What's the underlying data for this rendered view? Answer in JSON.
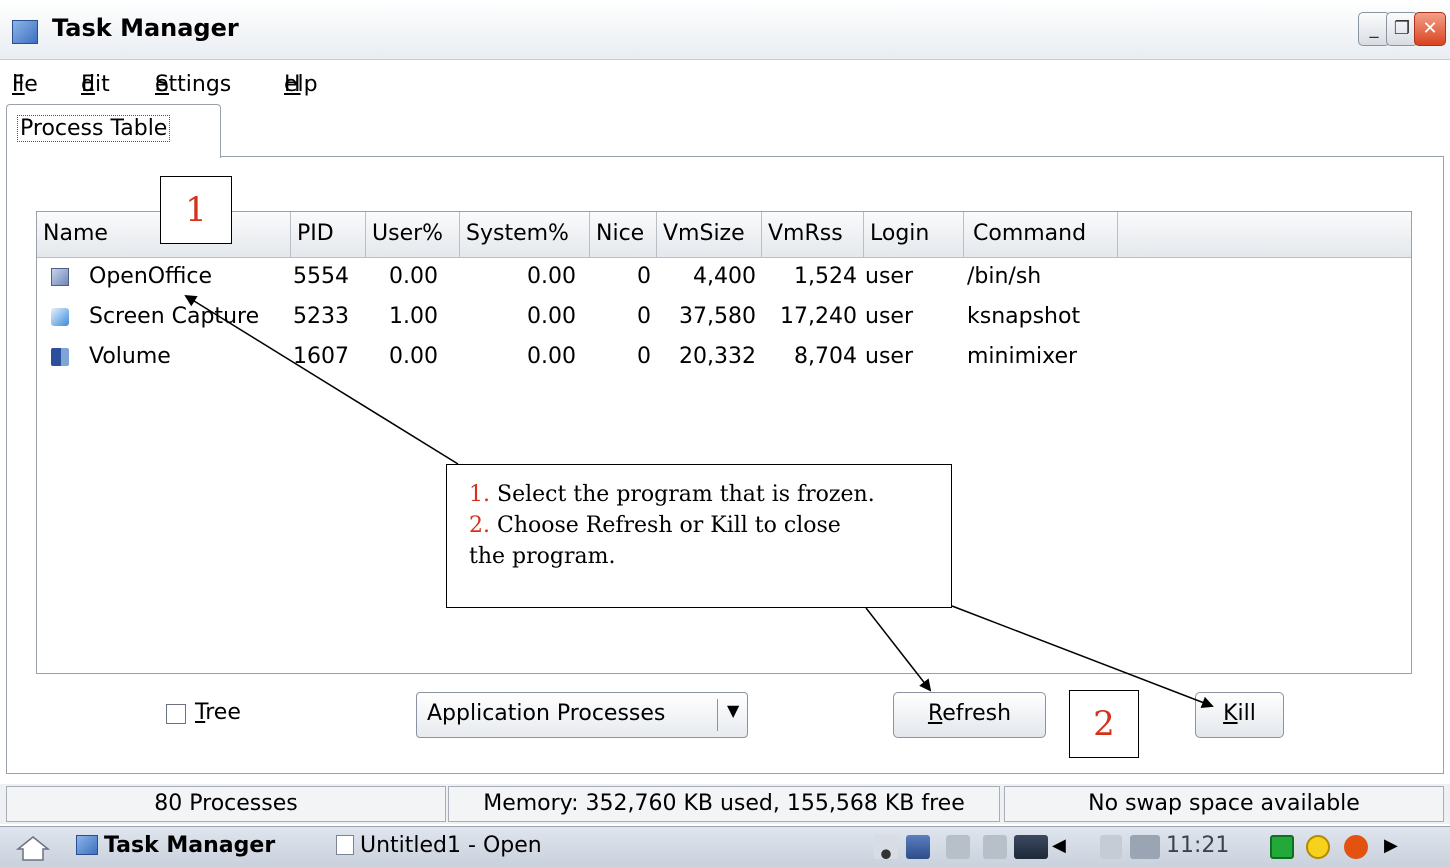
{
  "window": {
    "title": "Task Manager",
    "buttons": {
      "min": "_",
      "max": "❐",
      "close": "✕"
    }
  },
  "menu": [
    "File",
    "Edit",
    "Settings",
    "Help"
  ],
  "tab": {
    "label": "Process Table"
  },
  "table": {
    "columns": [
      "Name",
      "PID",
      "User%",
      "System%",
      "Nice",
      "VmSize",
      "VmRss",
      "Login",
      "Command"
    ],
    "rows": [
      {
        "icon": "openoffice-icon",
        "name": "OpenOffice",
        "pid": "5554",
        "user": "0.00",
        "system": "0.00",
        "nice": "0",
        "vmsize": "4,400",
        "vmrss": "1,524",
        "login": "user",
        "command": "/bin/sh"
      },
      {
        "icon": "screen-capture-icon",
        "name": "Screen Capture",
        "pid": "5233",
        "user": "1.00",
        "system": "0.00",
        "nice": "0",
        "vmsize": "37,580",
        "vmrss": "17,240",
        "login": "user",
        "command": "ksnapshot"
      },
      {
        "icon": "volume-icon",
        "name": "Volume",
        "pid": "1607",
        "user": "0.00",
        "system": "0.00",
        "nice": "0",
        "vmsize": "20,332",
        "vmrss": "8,704",
        "login": "user",
        "command": "minimixer"
      }
    ]
  },
  "controls": {
    "tree_label": "Tree",
    "filter_value": "Application Processes",
    "refresh_label": "Refresh",
    "kill_label": "Kill"
  },
  "annotations": {
    "marker1": "1",
    "marker2": "2",
    "step1_num": "1.",
    "step1_text": "Select the program that is frozen.",
    "step2_num": "2.",
    "step2_text": "Choose Refresh or Kill to close",
    "step2_text_cont": "the program."
  },
  "status": {
    "processes": "80 Processes",
    "memory": "Memory: 352,760 KB used, 155,568 KB free",
    "swap": "No swap space available"
  },
  "taskbar": {
    "items": [
      "Task Manager",
      "Untitled1 - Open"
    ],
    "clock": "11:21"
  }
}
